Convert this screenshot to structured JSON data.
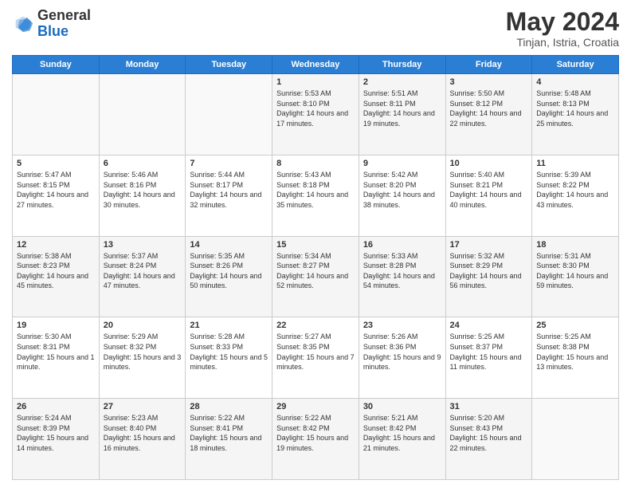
{
  "logo": {
    "general": "General",
    "blue": "Blue"
  },
  "title": {
    "month_year": "May 2024",
    "location": "Tinjan, Istria, Croatia"
  },
  "headers": [
    "Sunday",
    "Monday",
    "Tuesday",
    "Wednesday",
    "Thursday",
    "Friday",
    "Saturday"
  ],
  "weeks": [
    [
      {
        "day": "",
        "info": ""
      },
      {
        "day": "",
        "info": ""
      },
      {
        "day": "",
        "info": ""
      },
      {
        "day": "1",
        "info": "Sunrise: 5:53 AM\nSunset: 8:10 PM\nDaylight: 14 hours and 17 minutes."
      },
      {
        "day": "2",
        "info": "Sunrise: 5:51 AM\nSunset: 8:11 PM\nDaylight: 14 hours and 19 minutes."
      },
      {
        "day": "3",
        "info": "Sunrise: 5:50 AM\nSunset: 8:12 PM\nDaylight: 14 hours and 22 minutes."
      },
      {
        "day": "4",
        "info": "Sunrise: 5:48 AM\nSunset: 8:13 PM\nDaylight: 14 hours and 25 minutes."
      }
    ],
    [
      {
        "day": "5",
        "info": "Sunrise: 5:47 AM\nSunset: 8:15 PM\nDaylight: 14 hours and 27 minutes."
      },
      {
        "day": "6",
        "info": "Sunrise: 5:46 AM\nSunset: 8:16 PM\nDaylight: 14 hours and 30 minutes."
      },
      {
        "day": "7",
        "info": "Sunrise: 5:44 AM\nSunset: 8:17 PM\nDaylight: 14 hours and 32 minutes."
      },
      {
        "day": "8",
        "info": "Sunrise: 5:43 AM\nSunset: 8:18 PM\nDaylight: 14 hours and 35 minutes."
      },
      {
        "day": "9",
        "info": "Sunrise: 5:42 AM\nSunset: 8:20 PM\nDaylight: 14 hours and 38 minutes."
      },
      {
        "day": "10",
        "info": "Sunrise: 5:40 AM\nSunset: 8:21 PM\nDaylight: 14 hours and 40 minutes."
      },
      {
        "day": "11",
        "info": "Sunrise: 5:39 AM\nSunset: 8:22 PM\nDaylight: 14 hours and 43 minutes."
      }
    ],
    [
      {
        "day": "12",
        "info": "Sunrise: 5:38 AM\nSunset: 8:23 PM\nDaylight: 14 hours and 45 minutes."
      },
      {
        "day": "13",
        "info": "Sunrise: 5:37 AM\nSunset: 8:24 PM\nDaylight: 14 hours and 47 minutes."
      },
      {
        "day": "14",
        "info": "Sunrise: 5:35 AM\nSunset: 8:26 PM\nDaylight: 14 hours and 50 minutes."
      },
      {
        "day": "15",
        "info": "Sunrise: 5:34 AM\nSunset: 8:27 PM\nDaylight: 14 hours and 52 minutes."
      },
      {
        "day": "16",
        "info": "Sunrise: 5:33 AM\nSunset: 8:28 PM\nDaylight: 14 hours and 54 minutes."
      },
      {
        "day": "17",
        "info": "Sunrise: 5:32 AM\nSunset: 8:29 PM\nDaylight: 14 hours and 56 minutes."
      },
      {
        "day": "18",
        "info": "Sunrise: 5:31 AM\nSunset: 8:30 PM\nDaylight: 14 hours and 59 minutes."
      }
    ],
    [
      {
        "day": "19",
        "info": "Sunrise: 5:30 AM\nSunset: 8:31 PM\nDaylight: 15 hours and 1 minute."
      },
      {
        "day": "20",
        "info": "Sunrise: 5:29 AM\nSunset: 8:32 PM\nDaylight: 15 hours and 3 minutes."
      },
      {
        "day": "21",
        "info": "Sunrise: 5:28 AM\nSunset: 8:33 PM\nDaylight: 15 hours and 5 minutes."
      },
      {
        "day": "22",
        "info": "Sunrise: 5:27 AM\nSunset: 8:35 PM\nDaylight: 15 hours and 7 minutes."
      },
      {
        "day": "23",
        "info": "Sunrise: 5:26 AM\nSunset: 8:36 PM\nDaylight: 15 hours and 9 minutes."
      },
      {
        "day": "24",
        "info": "Sunrise: 5:25 AM\nSunset: 8:37 PM\nDaylight: 15 hours and 11 minutes."
      },
      {
        "day": "25",
        "info": "Sunrise: 5:25 AM\nSunset: 8:38 PM\nDaylight: 15 hours and 13 minutes."
      }
    ],
    [
      {
        "day": "26",
        "info": "Sunrise: 5:24 AM\nSunset: 8:39 PM\nDaylight: 15 hours and 14 minutes."
      },
      {
        "day": "27",
        "info": "Sunrise: 5:23 AM\nSunset: 8:40 PM\nDaylight: 15 hours and 16 minutes."
      },
      {
        "day": "28",
        "info": "Sunrise: 5:22 AM\nSunset: 8:41 PM\nDaylight: 15 hours and 18 minutes."
      },
      {
        "day": "29",
        "info": "Sunrise: 5:22 AM\nSunset: 8:42 PM\nDaylight: 15 hours and 19 minutes."
      },
      {
        "day": "30",
        "info": "Sunrise: 5:21 AM\nSunset: 8:42 PM\nDaylight: 15 hours and 21 minutes."
      },
      {
        "day": "31",
        "info": "Sunrise: 5:20 AM\nSunset: 8:43 PM\nDaylight: 15 hours and 22 minutes."
      },
      {
        "day": "",
        "info": ""
      }
    ]
  ]
}
